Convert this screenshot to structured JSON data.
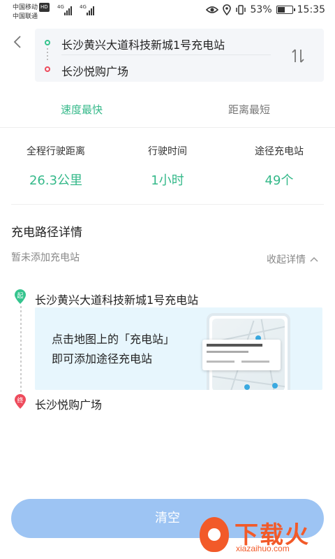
{
  "status_bar": {
    "carrier1": "中国移动",
    "hd": "HD",
    "carrier2": "中国联通",
    "network1": "4G",
    "network2": "4G",
    "battery_pct": "53%",
    "battery_level": 0.53,
    "time": "15:35"
  },
  "route": {
    "start": "长沙黄兴大道科技新城1号充电站",
    "end": "长沙悦购广场"
  },
  "tabs": [
    {
      "label": "速度最快",
      "active": true
    },
    {
      "label": "距离最短",
      "active": false
    }
  ],
  "stats": [
    {
      "label": "全程行驶距离",
      "value": "26.3公里"
    },
    {
      "label": "行驶时间",
      "value": "1小时"
    },
    {
      "label": "途径充电站",
      "value": "49个"
    }
  ],
  "details": {
    "title": "充电路径详情",
    "no_station": "暂未添加充电站",
    "collapse_label": "收起详情",
    "start_pin": "起",
    "end_pin": "终",
    "start_name": "长沙黄兴大道科技新城1号充电站",
    "end_name": "长沙悦购广场",
    "tip_line1": "点击地图上的「充电站」",
    "tip_line2": "即可添加途径充电站"
  },
  "clear_button": "清空",
  "watermark": {
    "title": "下载火",
    "url": "xiazaihuo.com"
  },
  "colors": {
    "accent": "#35b98a",
    "start_green": "#35c48e",
    "end_red": "#ee4b5c",
    "button": "#9dc4f3",
    "tip_bg": "#e7f6fd"
  }
}
